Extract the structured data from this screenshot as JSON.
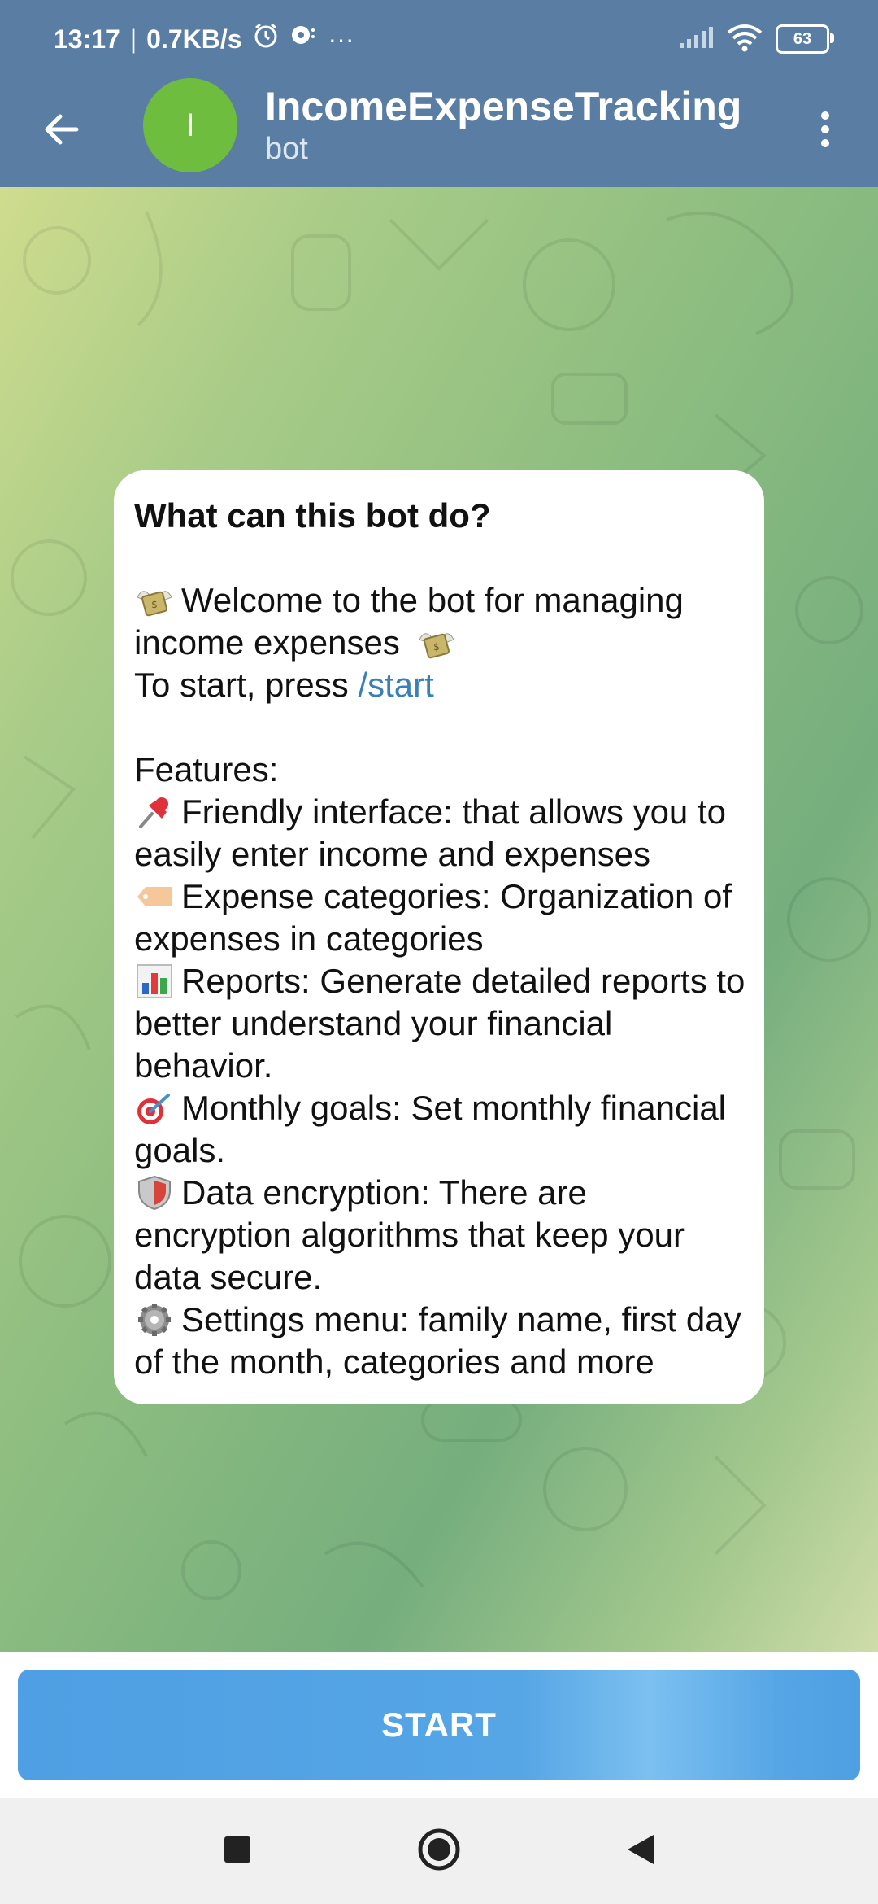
{
  "status_bar": {
    "time": "13:17",
    "separator": "|",
    "speed": "0.7KB/s",
    "more": "···",
    "battery": "63"
  },
  "header": {
    "avatar_letter": "I",
    "title": "IncomeExpenseTracking",
    "subtitle": "bot"
  },
  "bubble": {
    "title": "What can this bot do?",
    "welcome": "Welcome to the bot for managing income expenses",
    "start_prefix": "To start, press",
    "start_command": "/start",
    "features_label": "Features:",
    "features": [
      {
        "icon": "pushpin-icon",
        "text": "Friendly interface: that allows you to easily enter income and expenses"
      },
      {
        "icon": "label-tag-icon",
        "text": "Expense categories: Organization of expenses in categories"
      },
      {
        "icon": "bar-chart-icon",
        "text": "Reports: Generate detailed reports to better understand your financial behavior."
      },
      {
        "icon": "target-dart-icon",
        "text": "Monthly goals: Set monthly financial goals."
      },
      {
        "icon": "shield-icon",
        "text": "Data encryption: There are encryption algorithms that keep your data secure."
      },
      {
        "icon": "gear-icon",
        "text": "Settings menu: family name, first day of the month, categories and more"
      }
    ]
  },
  "start_button": {
    "label": "START"
  },
  "colors": {
    "header": "#5a7ea3",
    "avatar": "#6ebd3f",
    "link": "#3a80b8",
    "start_button": "#4e9fe3"
  }
}
